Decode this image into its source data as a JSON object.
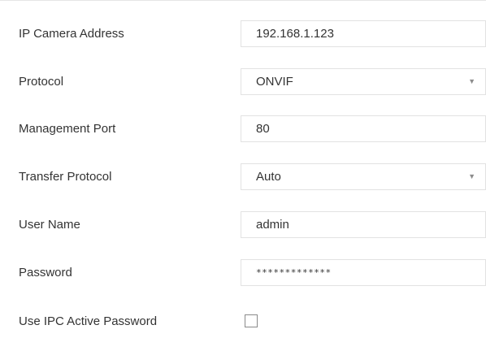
{
  "form": {
    "ip_address": {
      "label": "IP Camera Address",
      "value": "192.168.1.123"
    },
    "protocol": {
      "label": "Protocol",
      "value": "ONVIF",
      "dropdown_icon": "caret-down-icon"
    },
    "management_port": {
      "label": "Management Port",
      "value": "80"
    },
    "transfer_protocol": {
      "label": "Transfer Protocol",
      "value": "Auto",
      "dropdown_icon": "caret-down-icon"
    },
    "user_name": {
      "label": "User Name",
      "value": "admin"
    },
    "password": {
      "label": "Password",
      "value": "*************"
    },
    "use_ipc_active_password": {
      "label": "Use IPC Active Password",
      "checked": false
    }
  },
  "colors": {
    "text": "#333333",
    "border": "#e2e2e2",
    "checkbox_border": "#8a8a8a",
    "background": "#ffffff"
  }
}
